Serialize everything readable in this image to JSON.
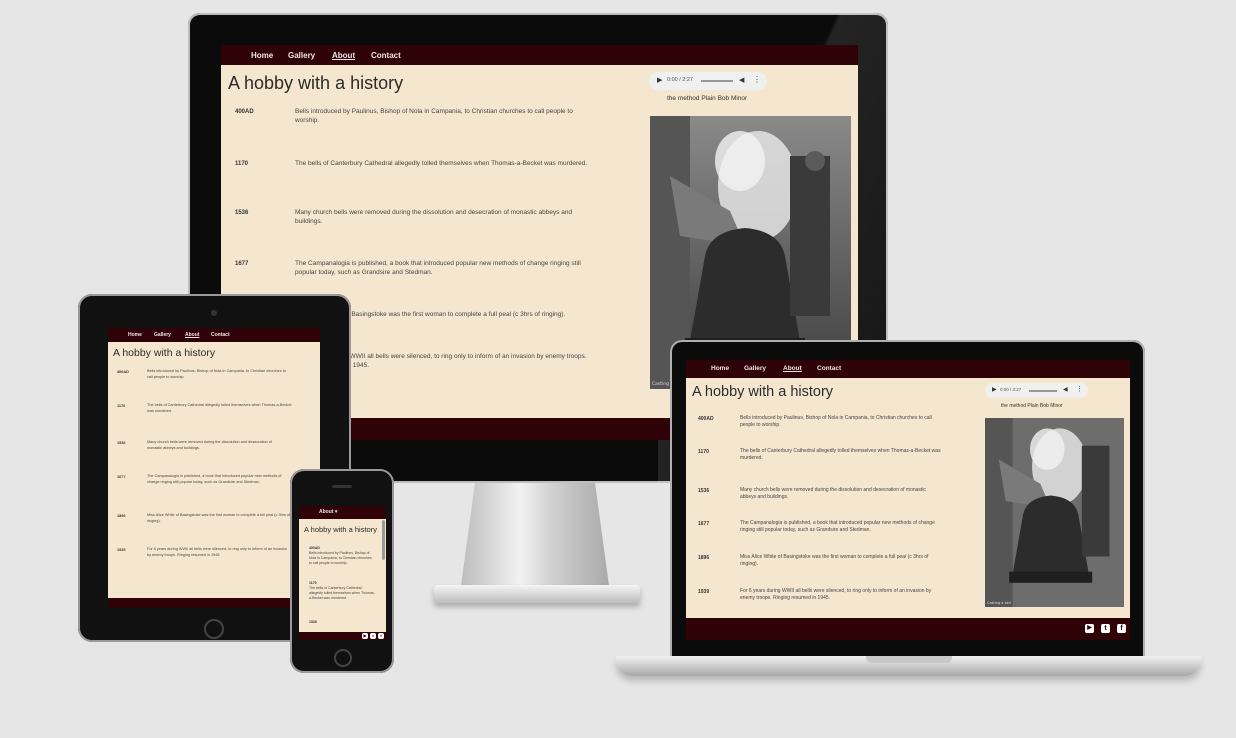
{
  "nav": {
    "home": "Home",
    "gallery": "Gallery",
    "about": "About",
    "contact": "Contact",
    "mobile_menu": "About ▾"
  },
  "page": {
    "title": "A hobby with a history"
  },
  "audio": {
    "time": "0:00 / 2:27",
    "caption": "the method Plain Bob Minor"
  },
  "photo": {
    "credit": "Casting a bell"
  },
  "timeline": [
    {
      "year": "400AD",
      "text": "Bells introduced by Paulinus, Bishop of Nola in Campania, to Christian churches to call people to worship."
    },
    {
      "year": "1170",
      "text": "The bells of Canterbury Cathedral allegedly tolled themselves when Thomas-a-Becket was murdered."
    },
    {
      "year": "1536",
      "text": "Many church bells were removed during the dissolution and desecration of monastic abbeys and buildings."
    },
    {
      "year": "1677",
      "text": "The Campanalogia is published, a book that introduced popular new methods of change ringing still popular today, such as Grandsire and Stedman."
    },
    {
      "year": "1896",
      "text": "Miss Alice White of Basingstoke was the first woman to complete a full peal (c 3hrs of ringing)."
    },
    {
      "year": "1939",
      "text": "For 6 years during WWII all bells were silenced, to ring only to inform of an invasion by enemy troops. Ringing resumed in 1945."
    }
  ],
  "social": {
    "youtube_icon": "youtube-icon",
    "twitter_icon": "twitter-icon",
    "facebook_icon": "facebook-icon",
    "youtube_glyph": "▶",
    "twitter_glyph": "t",
    "facebook_glyph": "f"
  },
  "colors": {
    "navbar": "#2f0208",
    "background": "#f5e7cf"
  }
}
